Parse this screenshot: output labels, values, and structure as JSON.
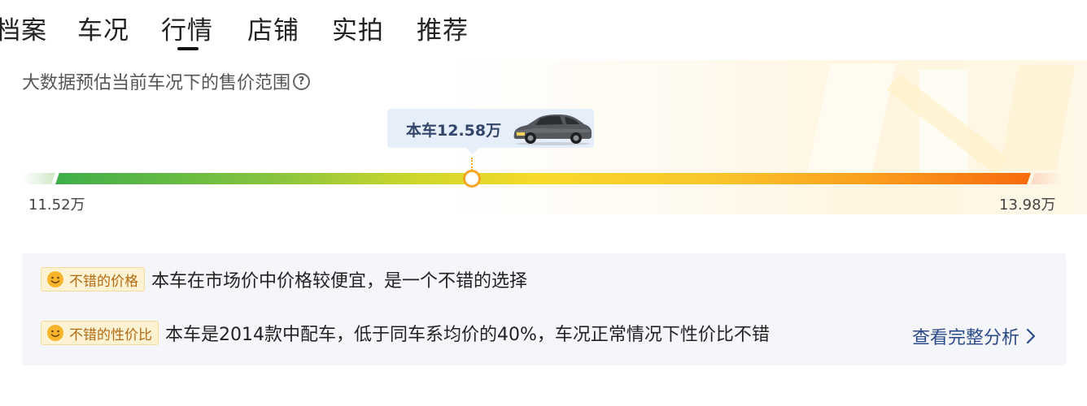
{
  "tabs": [
    {
      "label": "档案"
    },
    {
      "label": "车况"
    },
    {
      "label": "行情",
      "active": true
    },
    {
      "label": "店铺"
    },
    {
      "label": "实拍"
    },
    {
      "label": "推荐"
    }
  ],
  "price_section": {
    "subtitle": "大数据预估当前车况下的售价范围",
    "help_icon": "question-icon",
    "current_label": "本车12.58万",
    "current_price": 12.58,
    "min_label": "11.52万",
    "max_label": "13.98万",
    "min_price": 11.52,
    "max_price": 13.98,
    "car_icon": "car-icon"
  },
  "analysis": {
    "rows": [
      {
        "badge": "不错的价格",
        "text": "本车在市场价中价格较便宜，是一个不错的选择"
      },
      {
        "badge": "不错的性价比",
        "text": "本车是2014款中配车，低于同车系均价的40%，车况正常情况下性价比不错"
      }
    ],
    "link_label": "查看完整分析"
  },
  "colors": {
    "bar_start": "#3fae4a",
    "bar_mid": "#f8d92a",
    "bar_end": "#f86a0c",
    "marker": "#f5a623",
    "link": "#2b4a8a",
    "badge_text": "#b36a12"
  }
}
